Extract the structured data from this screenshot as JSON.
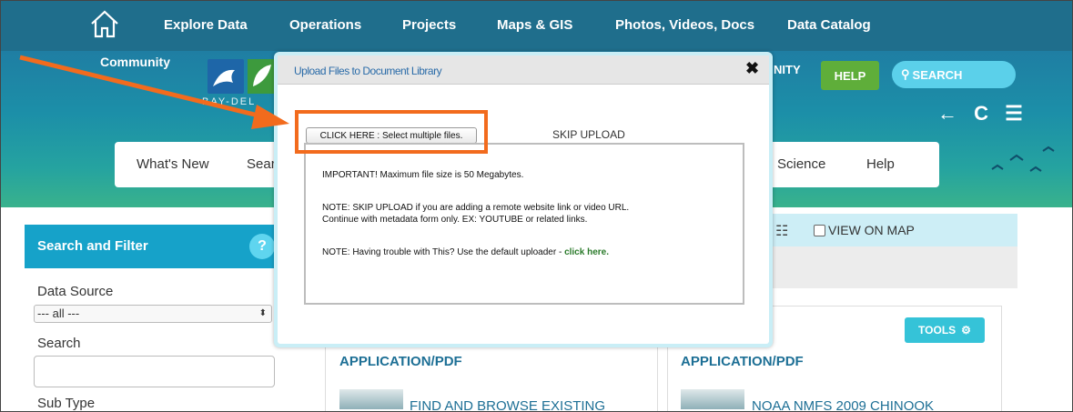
{
  "nav": {
    "items": [
      "Explore Data",
      "Operations",
      "Projects",
      "Maps & GIS",
      "Photos, Videos, Docs",
      "Data Catalog"
    ]
  },
  "banner": {
    "community": "Community",
    "bay_text": "BAY-DEL",
    "nity": "NITY",
    "help": "HELP",
    "search": "SEARCH",
    "icons": "← C ☰"
  },
  "menu": {
    "items": [
      "What's New",
      "Sear",
      "Science",
      "Help"
    ]
  },
  "filter": {
    "title": "Search and Filter",
    "help": "?",
    "data_source_label": "Data Source",
    "data_source_value": "--- all ---",
    "search_label": "Search",
    "subtype_label": "Sub Type"
  },
  "results": {
    "view_on_map": "VIEW ON MAP",
    "tools": "TOOLS",
    "cards": [
      {
        "type": "APPLICATION/PDF",
        "title": "FIND AND BROWSE EXISTING"
      },
      {
        "type": "APPLICATION/PDF",
        "title": "NOAA NMFS 2009 CHINOOK"
      }
    ]
  },
  "dialog": {
    "title": "Upload Files to Document Library",
    "close": "✖",
    "select_button": "CLICK HERE : Select multiple files.",
    "skip": "SKIP UPLOAD",
    "msg1": "IMPORTANT! Maximum file size is 50 Megabytes.",
    "msg2_line1": "NOTE: SKIP UPLOAD if you are adding a remote website link or video URL.",
    "msg2_line2": "Continue with metadata form only. EX: YOUTUBE or related links.",
    "msg3": "NOTE: Having trouble with This? Use the default uploader - ",
    "msg3_link": "click here."
  },
  "colors": {
    "nav_bg": "#1f6e8c",
    "accent": "#16a2c9",
    "highlight": "#f26b1d",
    "help_green": "#5fae3a"
  }
}
